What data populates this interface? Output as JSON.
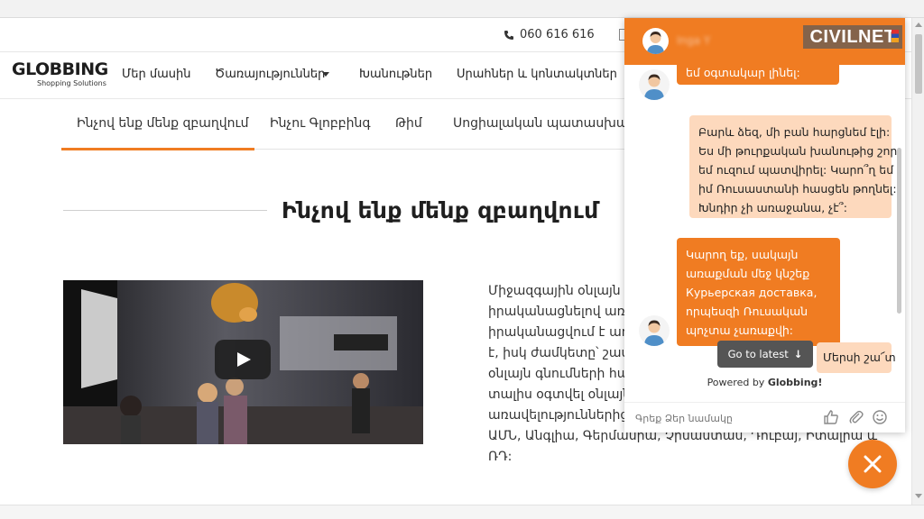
{
  "colors": {
    "accent": "#f07c22",
    "accent_light": "#fdd9bd",
    "dark_button": "#555555"
  },
  "contact_bar": {
    "phone": "060 616 616",
    "phone_icon": "phone-icon"
  },
  "header": {
    "logo_text": "GLOBBING",
    "logo_sub": "Shopping Solutions",
    "nav": [
      "Մեր մասին",
      "Ծառայություններ",
      "Խանութներ",
      "Սրահներ և կոնտակտներ"
    ]
  },
  "sub_tabs": [
    "Ինչով ենք մենք զբաղվում",
    "Ինչու Գլոբբինգ",
    "Թիմ",
    "Սոցիալական պատասխանատվ"
  ],
  "page_title": "Ինչով ենք մենք զբաղվում",
  "video": {
    "play_icon": "play-icon"
  },
  "body_lines": [
    "Միջազգային օնլայն ի",
    "իրականացնելով առաք",
    "իրականացվում է առա",
    "է, իսկ ժամկետը՝ շատ",
    "օնլայն գնումների հար",
    "տալիս օգտվել օնլայն",
    "առավելություններից",
    "ԱՄՆ, Անգլիա, Գերմանիա, Չինաստան, Դուբայ, Իտալիա և",
    "ՌԴ:"
  ],
  "chat": {
    "agent_name": "Inga Y",
    "brand_watermark": "CIVILNET",
    "messages": [
      {
        "from": "agent",
        "lines": [
          "եմ օգտակար լինել:"
        ]
      },
      {
        "from": "user",
        "lines": [
          "Բարև ձեզ, մի բան հարցնեմ էլի:",
          "Ես մի թուրքական խանութից շոր",
          "եմ ուզում պատվիրել: Կարո՞ղ եմ",
          "իմ Ռուսաստանի հասցեն թողնել:",
          "Խնդիր չի առաջանա, չէ՞:"
        ]
      },
      {
        "from": "agent",
        "lines": [
          "Կարող եք, սակայն",
          "առաքման մեջ կնշեք",
          "Курьерская доставка,",
          "որպեսզի Ռուսական",
          "պոչտա չառաքվի:"
        ]
      },
      {
        "from": "user",
        "lines": [
          "Մերսի շա՜տ"
        ]
      }
    ],
    "goto_latest": "Go to latest",
    "powered_by_prefix": "Powered by ",
    "powered_by_brand": "Globbing!",
    "input_placeholder": "Գրեք Ձեր նամակը",
    "tools": [
      "thumbs-up-icon",
      "paperclip-icon",
      "emoji-icon"
    ]
  },
  "fab_icon": "close-icon"
}
